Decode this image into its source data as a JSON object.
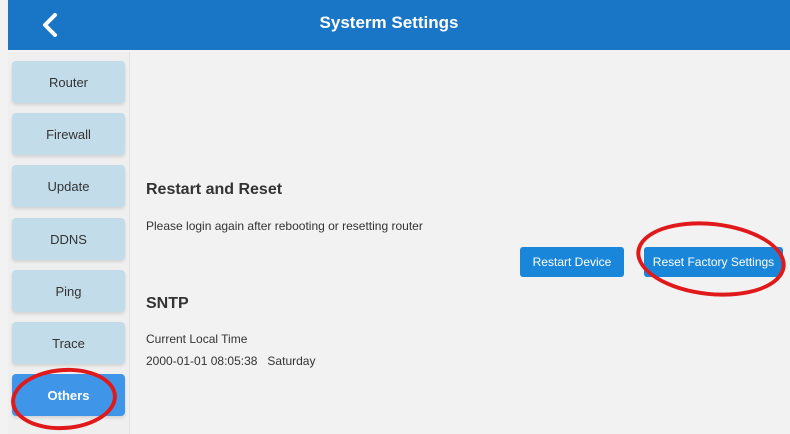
{
  "header": {
    "title": "Systerm Settings",
    "back_icon": "chevron-left-icon",
    "color": "#1976c7"
  },
  "sidebar": {
    "items": [
      {
        "label": "Router",
        "active": false
      },
      {
        "label": "Firewall",
        "active": false
      },
      {
        "label": "Update",
        "active": false
      },
      {
        "label": "DDNS",
        "active": false
      },
      {
        "label": "Ping",
        "active": false
      },
      {
        "label": "Trace",
        "active": false
      },
      {
        "label": "Others",
        "active": true
      }
    ],
    "active_color": "#3f96e8",
    "item_color": "#c3dcea"
  },
  "restart": {
    "title": "Restart and Reset",
    "description": "Please login again after rebooting or resetting router",
    "restart_label": "Restart Device",
    "reset_label": "Reset Factory Settings"
  },
  "sntp": {
    "title": "SNTP",
    "time_label": "Current Local Time",
    "time_value": "2000-01-01 08:05:38   Saturday"
  },
  "annotation_color": "#e01a1a"
}
